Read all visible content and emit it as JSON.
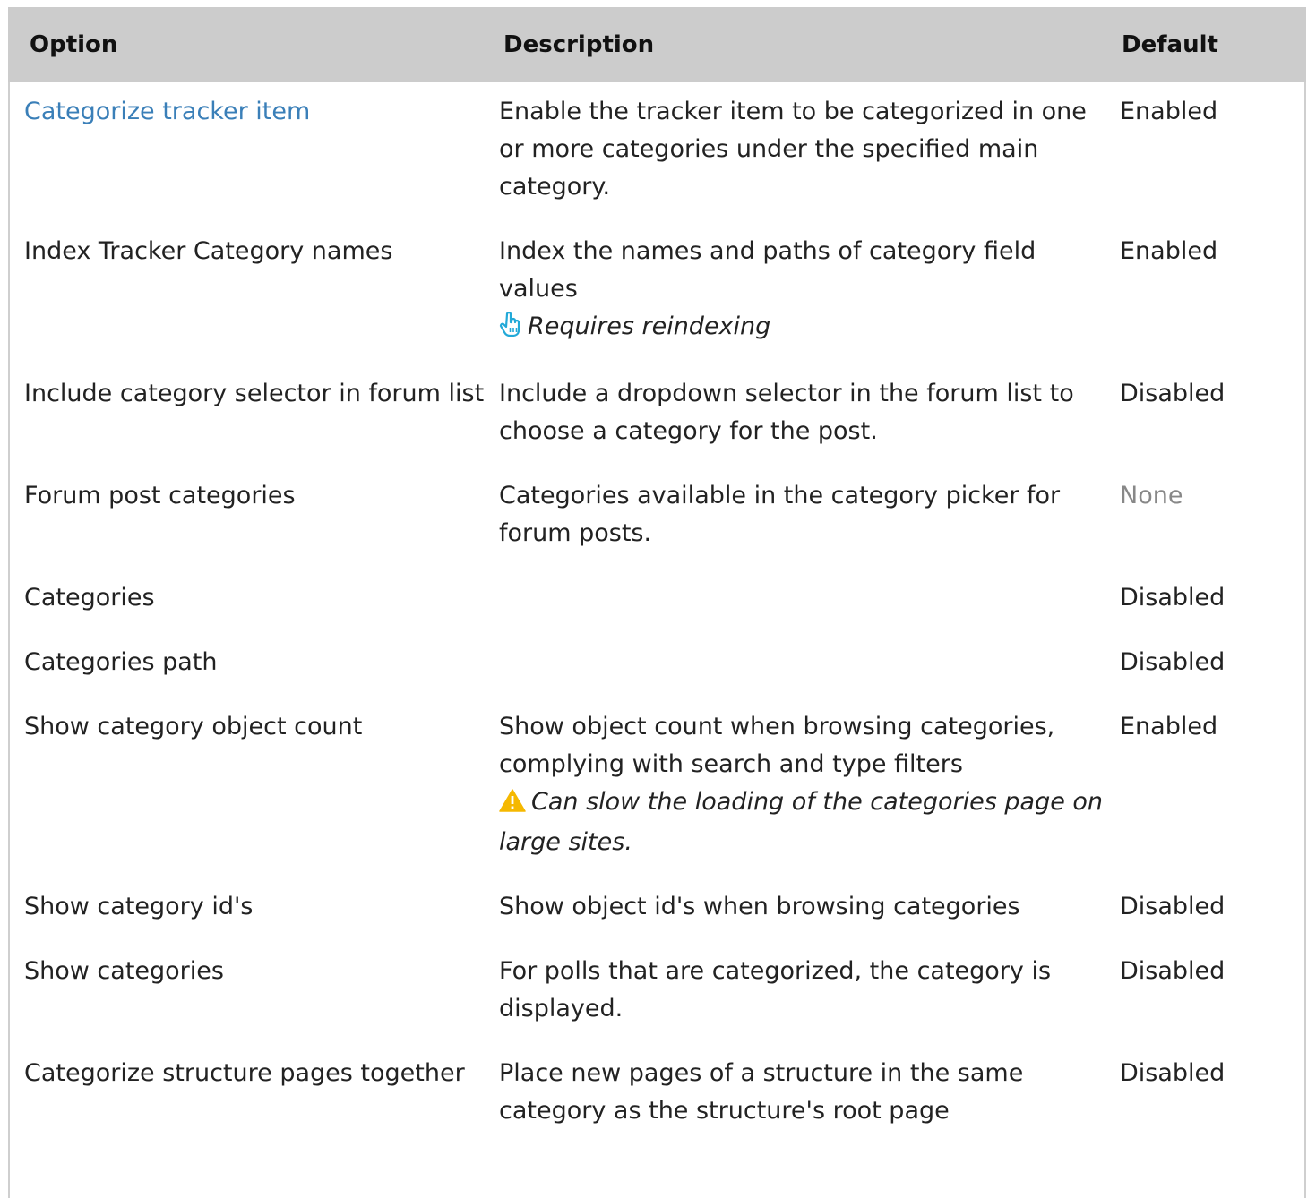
{
  "table": {
    "headers": {
      "option": "Option",
      "description": "Description",
      "default": "Default"
    },
    "rows": [
      {
        "option": "Categorize tracker item",
        "option_is_link": true,
        "description": "Enable the tracker item to be categorized in one or more categories under the specified main category.",
        "note": "",
        "note_icon": "",
        "default": "Enabled"
      },
      {
        "option": "Index Tracker Category names",
        "description": "Index the names and paths of category field values",
        "note": "Requires reindexing",
        "note_icon": "pointing-hand-icon",
        "default": "Enabled"
      },
      {
        "option": "Include category selector in forum list",
        "description": "Include a dropdown selector in the forum list to choose a category for the post.",
        "note": "",
        "note_icon": "",
        "default": "Disabled"
      },
      {
        "option": "Forum post categories",
        "description": "Categories available in the category picker for forum posts.",
        "note": "",
        "note_icon": "",
        "default": "None"
      },
      {
        "option": "Categories",
        "description": "",
        "note": "",
        "note_icon": "",
        "default": "Disabled"
      },
      {
        "option": "Categories path",
        "description": "",
        "note": "",
        "note_icon": "",
        "default": "Disabled"
      },
      {
        "option": "Show category object count",
        "description": "Show object count when browsing categories, complying with search and type filters",
        "note": "Can slow the loading of the categories page on large sites.",
        "note_icon": "warning-icon",
        "default": "Enabled"
      },
      {
        "option": "Show category id's",
        "description": "Show object id's when browsing categories",
        "note": "",
        "note_icon": "",
        "default": "Disabled"
      },
      {
        "option": "Show categories",
        "description": "For polls that are categorized, the category is displayed.",
        "note": "",
        "note_icon": "",
        "default": "Disabled"
      },
      {
        "option": "Categorize structure pages together",
        "description": "Place new pages of a structure in the same category as the structure's root page",
        "note": "",
        "note_icon": "",
        "default": "Disabled"
      }
    ]
  },
  "colors": {
    "header_bg": "#cccccc",
    "link": "#3a7fb8",
    "muted": "#888888",
    "hand_icon": "#22a9d8",
    "warning_icon": "#f5b800"
  }
}
